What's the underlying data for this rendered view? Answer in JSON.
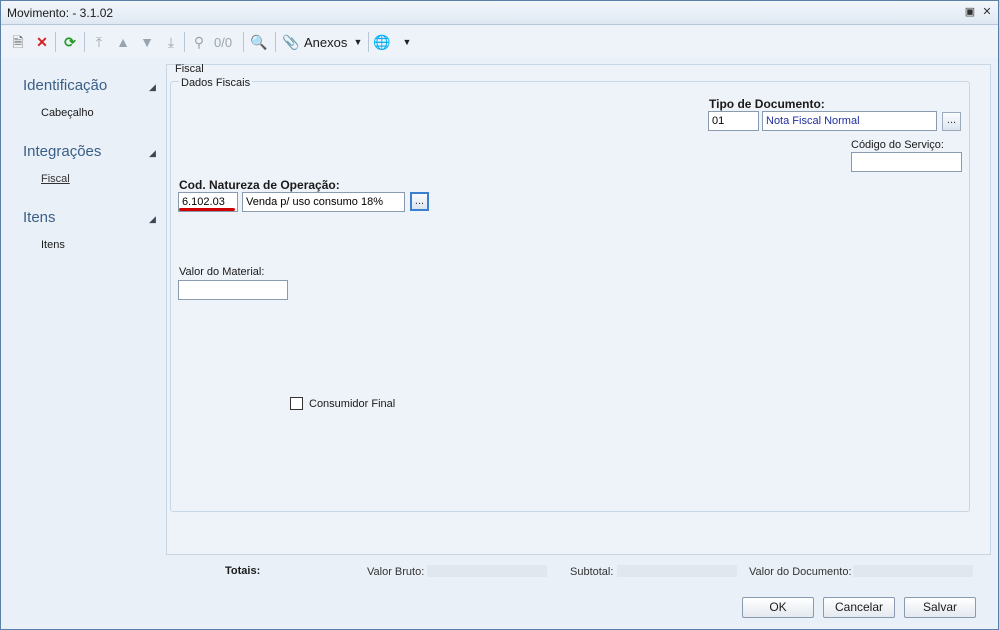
{
  "window": {
    "title": "Movimento:  - 3.1.02"
  },
  "toolbar": {
    "page_counter": "0/0",
    "attachments_label": "Anexos"
  },
  "nav": {
    "groups": [
      {
        "label": "Identificação",
        "items": [
          "Cabeçalho"
        ]
      },
      {
        "label": "Integrações",
        "items": [
          "Fiscal"
        ]
      },
      {
        "label": "Itens",
        "items": [
          "Itens"
        ]
      }
    ]
  },
  "section": {
    "title": "Fiscal",
    "group_title": "Dados Fiscais"
  },
  "form": {
    "tipo_documento_label": "Tipo de Documento:",
    "tipo_documento_code": "01",
    "tipo_documento_desc": "Nota Fiscal Normal",
    "codigo_servico_label": "Código do Serviço:",
    "codigo_servico_value": "",
    "natureza_label": "Cod. Natureza de Operação:",
    "natureza_code": "6.102.03",
    "natureza_desc": "Venda p/ uso consumo 18%",
    "valor_material_label": "Valor do Material:",
    "valor_material_value": "",
    "consumidor_final_label": "Consumidor Final",
    "lookup_label": "..."
  },
  "totals": {
    "label": "Totais:",
    "valor_bruto_label": "Valor Bruto:",
    "subtotal_label": "Subtotal:",
    "valor_documento_label": "Valor do Documento:"
  },
  "buttons": {
    "ok": "OK",
    "cancel": "Cancelar",
    "save": "Salvar"
  },
  "colors": {
    "accent": "#3a5f86",
    "error_underline": "#d00000",
    "link_text": "#1f2fa0"
  }
}
